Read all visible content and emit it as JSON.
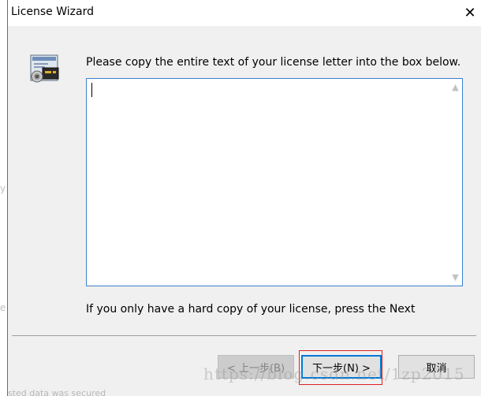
{
  "window": {
    "title": "License Wizard",
    "close_symbol": "✕"
  },
  "main": {
    "instruction": "Please copy the entire text of your license letter into the box below.",
    "license_text_value": "",
    "hint": "If you only have a hard copy of your license, press the Next"
  },
  "buttons": {
    "back_label": "< 上一步(B)",
    "next_label": "下一步(N) >",
    "cancel_label": "取消"
  },
  "watermark": {
    "text": "https://blog.csdn.net/1zp2015"
  },
  "background": {
    "fragment_1": "y",
    "fragment_2": "e",
    "bottom_fragment": "sted data was secured"
  },
  "colors": {
    "accent": "#0078d7",
    "highlight": "#e02020",
    "client_bg": "#f0f0f0"
  }
}
